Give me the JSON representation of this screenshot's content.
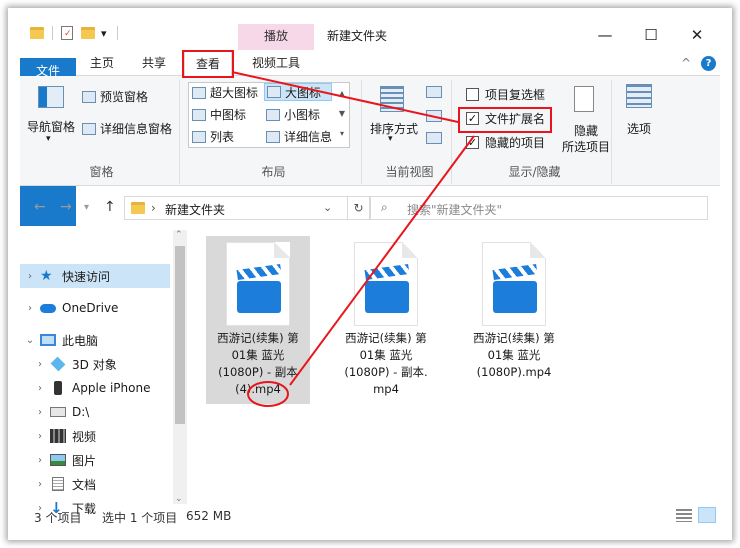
{
  "window": {
    "title": "新建文件夹",
    "context_tab": "播放",
    "minimize": "—",
    "maximize": "☐",
    "close": "✕",
    "quick_access_arrow": "▾"
  },
  "tabs": {
    "file": "文件",
    "home": "主页",
    "share": "共享",
    "view": "查看",
    "video_tools": "视频工具",
    "help": "?",
    "collapse": "^"
  },
  "ribbon": {
    "panes": {
      "nav_pane": "导航窗格",
      "preview_pane": "预览窗格",
      "details_pane": "详细信息窗格",
      "group_label": "窗格"
    },
    "layout": {
      "extra_large": "超大图标",
      "large": "大图标",
      "medium": "中图标",
      "small": "小图标",
      "list": "列表",
      "details": "详细信息",
      "group_label": "布局"
    },
    "current_view": {
      "sort_by": "排序方式",
      "group_label": "当前视图"
    },
    "show_hide": {
      "item_checkboxes": "项目复选框",
      "item_checkboxes_checked": false,
      "file_extensions": "文件扩展名",
      "file_extensions_checked": true,
      "hidden_items": "隐藏的项目",
      "hidden_items_checked": true,
      "hide_selected_1": "隐藏",
      "hide_selected_2": "所选项目",
      "group_label": "显示/隐藏"
    },
    "options": "选项"
  },
  "address": {
    "path": "新建文件夹",
    "search_placeholder": "搜索\"新建文件夹\""
  },
  "nav": {
    "items": [
      {
        "label": "快速访问",
        "icon": "star-icon"
      },
      {
        "label": "OneDrive",
        "icon": "cloud-icon"
      },
      {
        "label": "此电脑",
        "icon": "computer-icon"
      },
      {
        "label": "3D 对象",
        "icon": "cube-icon"
      },
      {
        "label": "Apple iPhone",
        "icon": "phone-icon"
      },
      {
        "label": "D:\\",
        "icon": "drive-icon"
      },
      {
        "label": "视频",
        "icon": "video-icon"
      },
      {
        "label": "图片",
        "icon": "picture-icon"
      },
      {
        "label": "文档",
        "icon": "document-icon"
      },
      {
        "label": "下载",
        "icon": "download-icon"
      }
    ]
  },
  "files": [
    {
      "line1": "西游记(续集) 第",
      "line2": "01集 蓝光",
      "line3": "(1080P) - 副本",
      "line4": "(4).mp4"
    },
    {
      "line1": "西游记(续集) 第",
      "line2": "01集 蓝光",
      "line3": "(1080P) - 副本.",
      "line4": "mp4"
    },
    {
      "line1": "西游记(续集) 第",
      "line2": "01集 蓝光",
      "line3": "(1080P).mp4",
      "line4": ""
    }
  ],
  "status": {
    "count": "3 个项目",
    "selection": "选中 1 个项目",
    "size": "652 MB"
  },
  "colors": {
    "accent": "#1979ca",
    "annotation": "#e8161c",
    "context_tab": "#f6d8e8"
  }
}
